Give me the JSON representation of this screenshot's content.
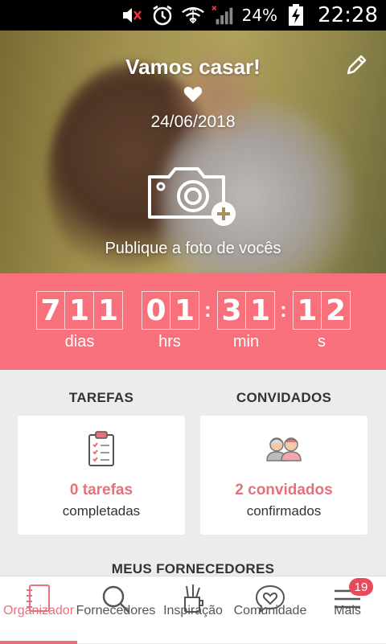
{
  "status_bar": {
    "battery": "24%",
    "time": "22:28"
  },
  "hero": {
    "title": "Vamos casar!",
    "date": "24/06/2018",
    "photo_prompt": "Publique a foto de vocês"
  },
  "countdown": {
    "days": [
      "7",
      "1",
      "1"
    ],
    "hours": [
      "0",
      "1"
    ],
    "minutes": [
      "3",
      "1"
    ],
    "seconds": [
      "1",
      "2"
    ],
    "labels": {
      "days": "dias",
      "hours": "hrs",
      "minutes": "min",
      "seconds": "s"
    }
  },
  "tasks": {
    "heading": "TAREFAS",
    "value": "0 tarefas",
    "subtitle": "completadas"
  },
  "guests": {
    "heading": "CONVIDADOS",
    "value": "2 convidados",
    "subtitle": "confirmados"
  },
  "suppliers": {
    "heading": "MEUS FORNECEDORES"
  },
  "tabs": [
    {
      "label": "Organizador",
      "icon": "notebook-icon",
      "active": true
    },
    {
      "label": "Fornecedores",
      "icon": "search-icon"
    },
    {
      "label": "Inspiração",
      "icon": "pencil-cup-icon"
    },
    {
      "label": "Comunidade",
      "icon": "heart-chat-icon"
    },
    {
      "label": "Mais",
      "icon": "menu-icon",
      "badge": "19"
    }
  ],
  "colors": {
    "accent": "#f8707c",
    "accent_text": "#e8707a",
    "badge": "#e84a5a"
  }
}
